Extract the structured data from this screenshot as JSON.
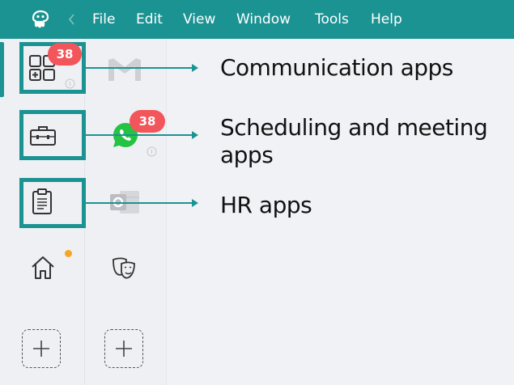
{
  "menubar": {
    "logo_icon": "octopus-logo-icon",
    "back_icon": "chevron-left-icon",
    "items": [
      "File",
      "Edit",
      "View",
      "Window",
      "Tools",
      "Help"
    ]
  },
  "sidebar": {
    "categories": [
      {
        "icon": "apps-grid-icon",
        "badge": "38"
      },
      {
        "icon": "briefcase-icon"
      },
      {
        "icon": "clipboard-icon"
      },
      {
        "icon": "home-icon"
      }
    ],
    "apps": [
      {
        "icon": "gmail-icon"
      },
      {
        "icon": "whatsapp-icon",
        "badge": "38"
      },
      {
        "icon": "outlook-icon"
      },
      {
        "icon": "theater-masks-icon"
      }
    ],
    "add_icon": "plus-icon"
  },
  "annotations": {
    "communication": "Communication apps",
    "scheduling_line1": "Scheduling and meeting",
    "scheduling_line2": "apps",
    "hr": "HR apps"
  },
  "colors": {
    "accent": "#1c9393",
    "badge": "#f2555a",
    "notification": "#f5a623"
  }
}
